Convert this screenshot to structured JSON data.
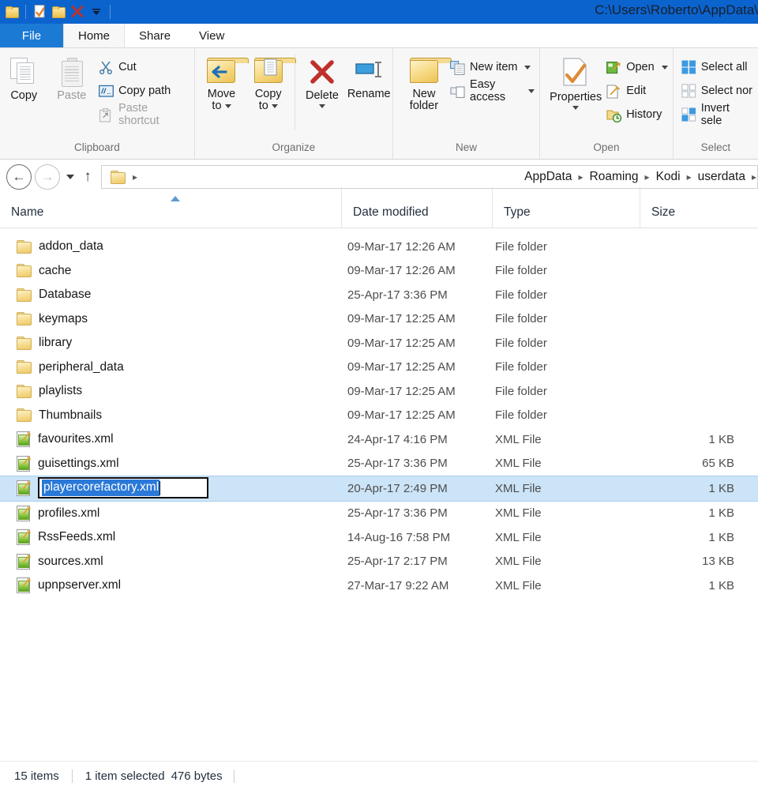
{
  "titlebar": {
    "path_title": "C:\\Users\\Roberto\\AppData\\",
    "quick_access": [
      {
        "name": "folder-icon",
        "label": "Folder"
      },
      {
        "name": "properties-icon",
        "label": "Properties"
      },
      {
        "name": "new-folder-icon",
        "label": "New folder"
      },
      {
        "name": "delete-icon",
        "label": "Delete"
      },
      {
        "name": "customize-qat-icon",
        "label": "Customize Quick Access Toolbar"
      }
    ]
  },
  "tabs": {
    "file": "File",
    "items": [
      {
        "label": "Home",
        "active": true
      },
      {
        "label": "Share",
        "active": false
      },
      {
        "label": "View",
        "active": false
      }
    ]
  },
  "ribbon": {
    "groups": [
      {
        "label": "Clipboard",
        "big": [
          {
            "label": "Copy",
            "icon": "copy-icon",
            "disabled": false
          },
          {
            "label": "Paste",
            "icon": "paste-icon",
            "disabled": true
          }
        ],
        "small": [
          {
            "label": "Cut",
            "icon": "cut-scissors-icon",
            "disabled": false
          },
          {
            "label": "Copy path",
            "icon": "copy-path-icon",
            "disabled": false
          },
          {
            "label": "Paste shortcut",
            "icon": "paste-shortcut-icon",
            "disabled": true
          }
        ]
      },
      {
        "label": "Organize",
        "big": [
          {
            "label": "Move",
            "label2": "to",
            "icon": "move-to-icon",
            "dropdown": true
          },
          {
            "label": "Copy",
            "label2": "to",
            "icon": "copy-to-icon",
            "dropdown": true
          },
          {
            "label": "Delete",
            "icon": "delete-x-icon",
            "dropdown": true
          },
          {
            "label": "Rename",
            "icon": "rename-icon",
            "dropdown": false
          }
        ]
      },
      {
        "label": "New",
        "big": [
          {
            "label": "New",
            "label2": "folder",
            "icon": "new-folder-icon"
          }
        ],
        "small": [
          {
            "label": "New item",
            "icon": "new-item-icon",
            "dropdown": true
          },
          {
            "label": "Easy access",
            "icon": "easy-access-icon",
            "dropdown": true
          }
        ]
      },
      {
        "label": "Open",
        "big": [
          {
            "label": "Properties",
            "icon": "properties-icon",
            "dropdown": true
          }
        ],
        "small": [
          {
            "label": "Open",
            "icon": "open-icon",
            "dropdown": true
          },
          {
            "label": "Edit",
            "icon": "edit-icon",
            "dropdown": false
          },
          {
            "label": "History",
            "icon": "history-icon",
            "dropdown": false
          }
        ]
      },
      {
        "label": "Select",
        "small": [
          {
            "label": "Select all",
            "icon": "select-all-icon"
          },
          {
            "label": "Select nor",
            "icon": "select-none-icon"
          },
          {
            "label": "Invert sele",
            "icon": "invert-selection-icon"
          }
        ]
      }
    ]
  },
  "addressbar": {
    "back_glyph": "←",
    "forward_glyph": "→",
    "up_glyph": "↑",
    "separator": "▸",
    "crumbs": [
      "AppData",
      "Roaming",
      "Kodi",
      "userdata"
    ]
  },
  "columns": [
    {
      "label": "Name",
      "sorted": "asc"
    },
    {
      "label": "Date modified",
      "sorted": ""
    },
    {
      "label": "Type",
      "sorted": ""
    },
    {
      "label": "Size",
      "sorted": ""
    }
  ],
  "files": [
    {
      "name": "addon_data",
      "date": "09-Mar-17 12:26 AM",
      "type": "File folder",
      "size": "",
      "icon": "folder-icon",
      "selected": false
    },
    {
      "name": "cache",
      "date": "09-Mar-17 12:26 AM",
      "type": "File folder",
      "size": "",
      "icon": "folder-icon",
      "selected": false
    },
    {
      "name": "Database",
      "date": "25-Apr-17 3:36 PM",
      "type": "File folder",
      "size": "",
      "icon": "folder-icon",
      "selected": false
    },
    {
      "name": "keymaps",
      "date": "09-Mar-17 12:25 AM",
      "type": "File folder",
      "size": "",
      "icon": "folder-icon",
      "selected": false
    },
    {
      "name": "library",
      "date": "09-Mar-17 12:25 AM",
      "type": "File folder",
      "size": "",
      "icon": "folder-icon",
      "selected": false
    },
    {
      "name": "peripheral_data",
      "date": "09-Mar-17 12:25 AM",
      "type": "File folder",
      "size": "",
      "icon": "folder-icon",
      "selected": false
    },
    {
      "name": "playlists",
      "date": "09-Mar-17 12:25 AM",
      "type": "File folder",
      "size": "",
      "icon": "folder-icon",
      "selected": false
    },
    {
      "name": "Thumbnails",
      "date": "09-Mar-17 12:25 AM",
      "type": "File folder",
      "size": "",
      "icon": "folder-icon",
      "selected": false
    },
    {
      "name": "favourites.xml",
      "date": "24-Apr-17 4:16 PM",
      "type": "XML File",
      "size": "1 KB",
      "icon": "xml-file-icon",
      "selected": false
    },
    {
      "name": "guisettings.xml",
      "date": "25-Apr-17 3:36 PM",
      "type": "XML File",
      "size": "65 KB",
      "icon": "xml-file-icon",
      "selected": false
    },
    {
      "name": "playercorefactory.xml",
      "date": "20-Apr-17 2:49 PM",
      "type": "XML File",
      "size": "1 KB",
      "icon": "xml-file-icon",
      "selected": true,
      "renaming": true
    },
    {
      "name": "profiles.xml",
      "date": "25-Apr-17 3:36 PM",
      "type": "XML File",
      "size": "1 KB",
      "icon": "xml-file-icon",
      "selected": false
    },
    {
      "name": "RssFeeds.xml",
      "date": "14-Aug-16 7:58 PM",
      "type": "XML File",
      "size": "1 KB",
      "icon": "xml-file-icon",
      "selected": false
    },
    {
      "name": "sources.xml",
      "date": "25-Apr-17 2:17 PM",
      "type": "XML File",
      "size": "13 KB",
      "icon": "xml-file-icon",
      "selected": false
    },
    {
      "name": "upnpserver.xml",
      "date": "27-Mar-17 9:22 AM",
      "type": "XML File",
      "size": "1 KB",
      "icon": "xml-file-icon",
      "selected": false
    }
  ],
  "rename_edit": {
    "value": "playercorefactory.xml",
    "selected_text": "playercorefactory.xml"
  },
  "statusbar": {
    "item_count": "15 items",
    "selection": "1 item selected",
    "selection_size": "476 bytes"
  },
  "colors": {
    "titlebar_blue": "#0b63ce",
    "file_tab_blue": "#1b7ad4",
    "row_selected": "#cce4f7",
    "text_selection_blue": "#2a79d8",
    "sort_arrow": "#5f9bd0",
    "folder_yellow": "#f6d87c"
  }
}
